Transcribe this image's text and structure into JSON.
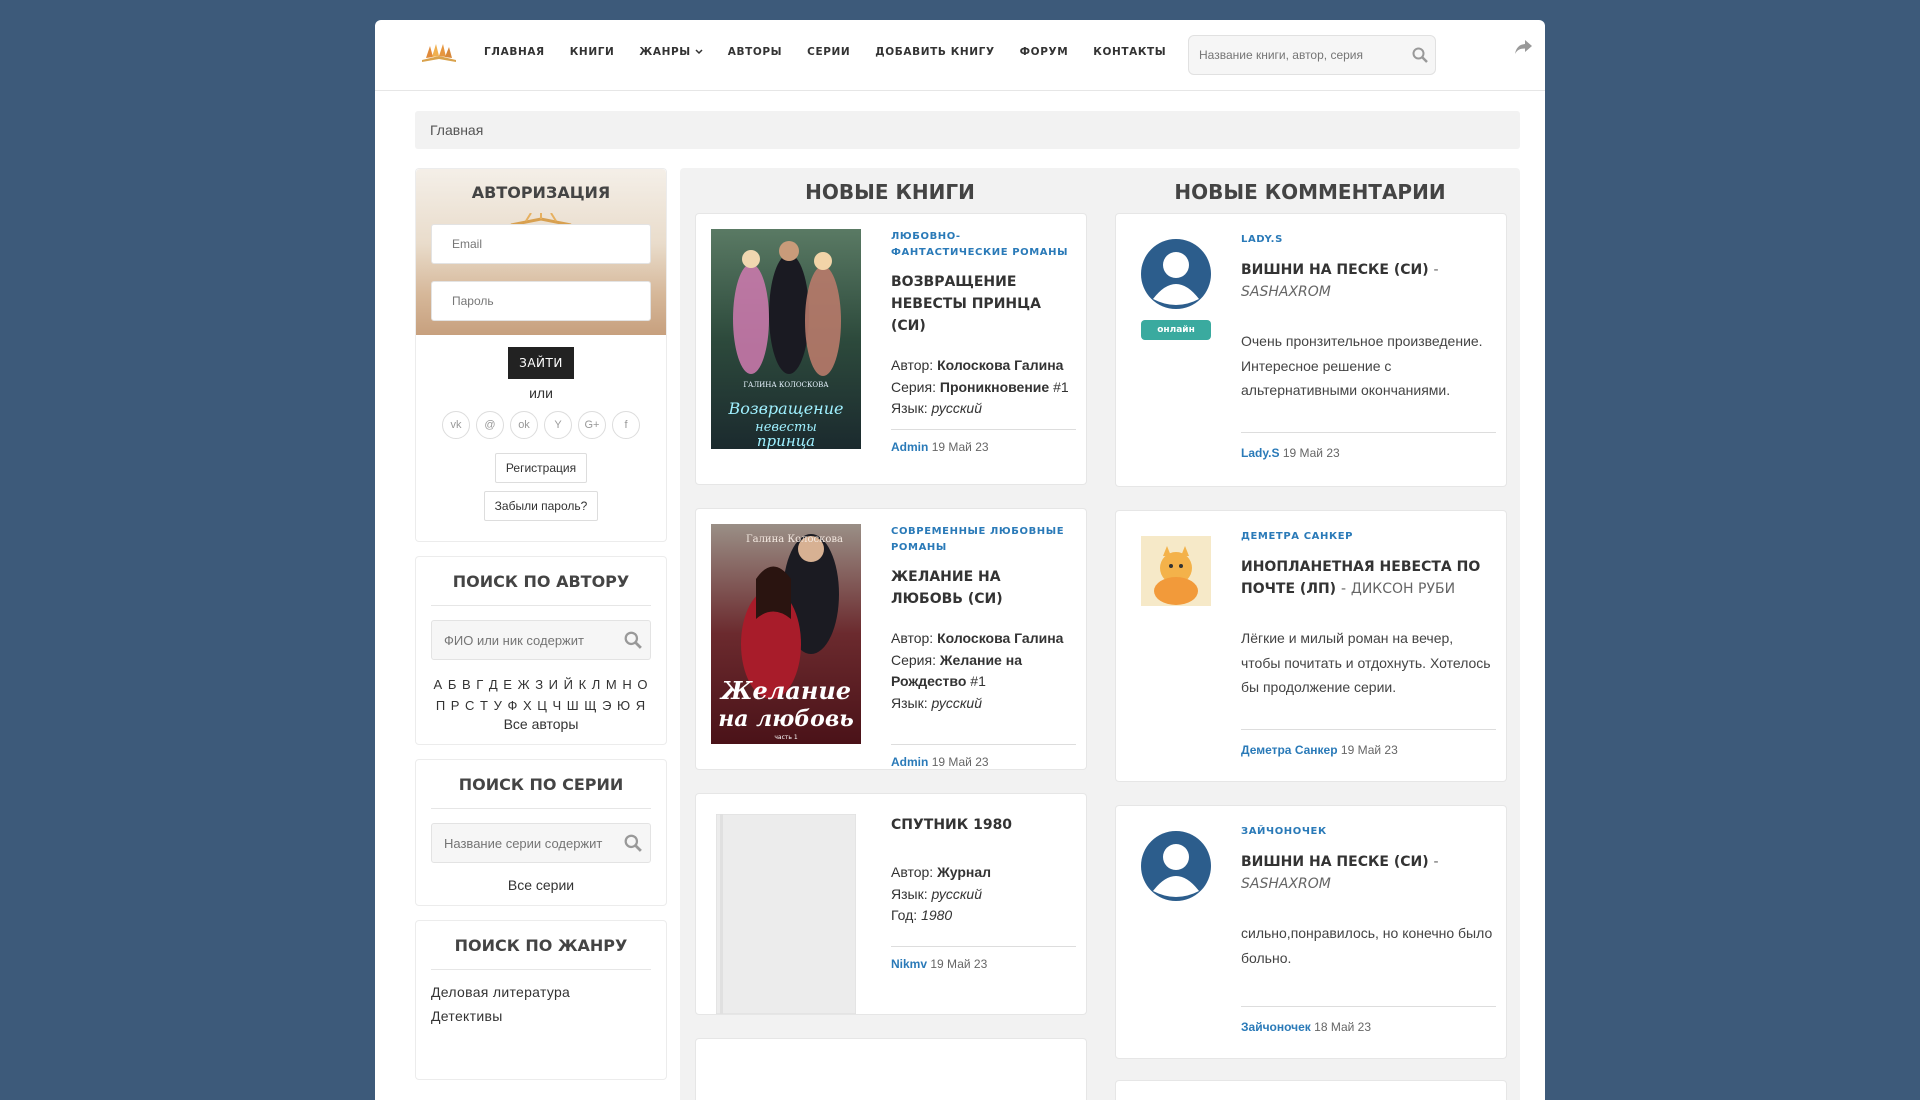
{
  "nav": {
    "items": [
      "ГЛАВНАЯ",
      "КНИГИ",
      "ЖАНРЫ",
      "АВТОРЫ",
      "СЕРИИ",
      "ДОБАВИТЬ КНИГУ",
      "ФОРУМ",
      "КОНТАКТЫ"
    ],
    "search_placeholder": "Название книги, автор, серия",
    "icons": {
      "search": "search-icon",
      "share": "share-icon",
      "dropdown": "chevron-down-icon"
    }
  },
  "breadcrumb": "Главная",
  "auth": {
    "title": "АВТОРИЗАЦИЯ",
    "email_placeholder": "Email",
    "password_placeholder": "Пароль",
    "login_label": "ЗАЙТИ",
    "or_label": "или",
    "socials": [
      "vk",
      "@",
      "ok",
      "Y",
      "G+",
      "f"
    ],
    "register_label": "Регистрация",
    "forgot_label": "Забыли пароль?"
  },
  "author_search": {
    "title": "ПОИСК ПО АВТОРУ",
    "placeholder": "ФИО или ник содержит",
    "letters_row1": "А Б В Г Д Е Ж З И Й К Л М Н О",
    "letters_row2": "П Р С Т У Ф Х Ц Ч Ш Щ Э Ю Я",
    "all_label": "Все авторы"
  },
  "series_search": {
    "title": "ПОИСК ПО СЕРИИ",
    "placeholder": "Название серии содержит",
    "all_label": "Все серии"
  },
  "genre_search": {
    "title": "ПОИСК ПО ЖАНРУ",
    "genres": [
      "Деловая литература",
      "Детективы"
    ]
  },
  "main": {
    "books_title": "НОВЫЕ КНИГИ",
    "comments_title": "НОВЫЕ КОММЕНТАРИИ"
  },
  "books": [
    {
      "genre": "ЛЮБОВНО-ФАНТАСТИЧЕСКИЕ РОМАНЫ",
      "title": "ВОЗВРАЩЕНИЕ НЕВЕСТЫ ПРИНЦА (СИ)",
      "author_label": "Автор:",
      "author": "Колоскова Галина",
      "series_label": "Серия:",
      "series": "Проникновение",
      "series_num": "#1",
      "lang_label": "Язык:",
      "lang": "русский",
      "user": "Admin",
      "date": "19 Май 23",
      "cover_text": "Возвращение невесты принца",
      "cover_author": "ГАЛИНА КОЛОСКОВА"
    },
    {
      "genre": "СОВРЕМЕННЫЕ ЛЮБОВНЫЕ РОМАНЫ",
      "title": "ЖЕЛАНИЕ НА ЛЮБОВЬ (СИ)",
      "author_label": "Автор:",
      "author": "Колоскова Галина",
      "series_label": "Серия:",
      "series": "Желание на Рождество",
      "series_num": "#1",
      "lang_label": "Язык:",
      "lang": "русский",
      "user": "Admin",
      "date": "19 Май 23",
      "cover_text": "Желание на любовь",
      "cover_author": "Галина Колоскова",
      "cover_sub": "часть 1"
    },
    {
      "title": "СПУТНИК 1980",
      "author_label": "Автор:",
      "author": "Журнал",
      "lang_label": "Язык:",
      "lang": "русский",
      "year_label": "Год:",
      "year": "1980",
      "user": "Nikmv",
      "date": "19 Май 23"
    }
  ],
  "comments": [
    {
      "user_tag": "LADY.S",
      "title": "ВИШНИ НА ПЕСКЕ (СИ)",
      "author": "SASHAXROM",
      "online": "онлайн",
      "text": "Очень пронзительное произведение. Интересное решение с альтернативными окончаниями.",
      "user": "Lady.S",
      "date": "19 Май 23"
    },
    {
      "user_tag": "ДЕМЕТРА САНКЕР",
      "title": "ИНОПЛАНЕТНАЯ НЕВЕСТА ПО ПОЧТЕ (ЛП)",
      "author": "ДИКСОН РУБИ",
      "text": "Лёгкие и милый роман на вечер, чтобы почитать и отдохнуть. Хотелось бы продолжение серии.",
      "user": "Деметра Санкер",
      "date": "19 Май 23"
    },
    {
      "user_tag": "ЗАЙЧОНОЧЕК",
      "title": "ВИШНИ НА ПЕСКЕ (СИ)",
      "author": "SASHAXROM",
      "text": "сильно,понравилось, но конечно было больно.",
      "user": "Зайчоночек",
      "date": "18 Май 23"
    }
  ],
  "colors": {
    "background": "#3d5a7a",
    "link": "#2a7ab8",
    "online": "#3aaa9f",
    "button_dark": "#222222"
  }
}
